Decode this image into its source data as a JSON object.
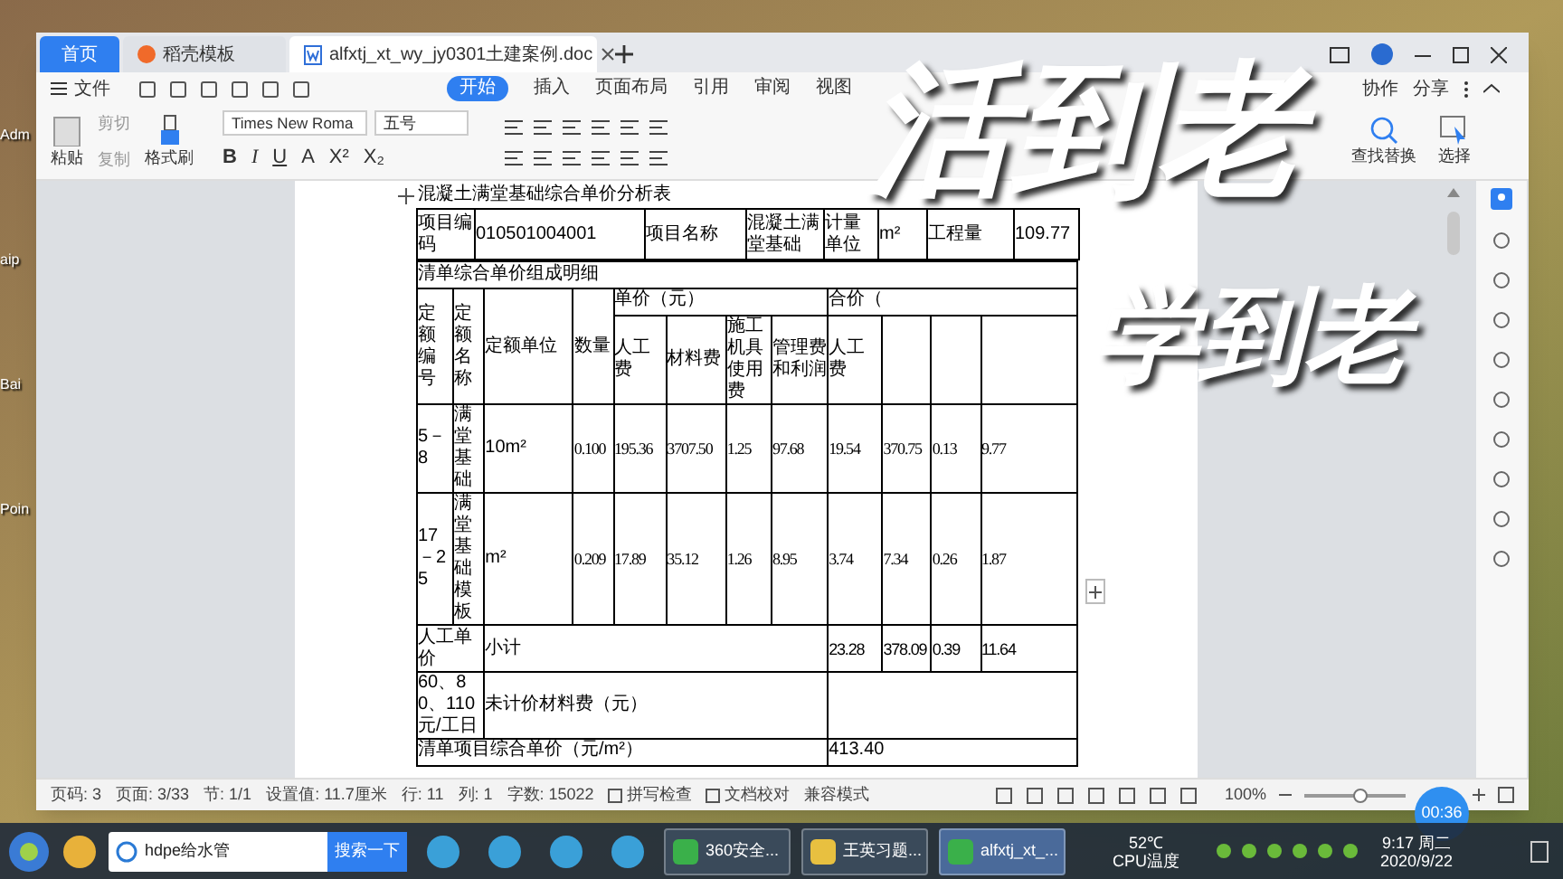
{
  "desktop_icons": [
    "Adm",
    "aip",
    "Bai",
    "Poin"
  ],
  "tabs": [
    {
      "label": "首页",
      "selected": false,
      "kind": "home"
    },
    {
      "label": "稻壳模板",
      "selected": false,
      "kind": "template"
    },
    {
      "label": "alfxtj_xt_wy_jy0301土建案例.doc",
      "selected": true,
      "kind": "doc"
    }
  ],
  "menu": {
    "file": "文件",
    "tabs": [
      {
        "label": "开始",
        "selected": true
      },
      {
        "label": "插入",
        "selected": false
      },
      {
        "label": "页面布局",
        "selected": false
      },
      {
        "label": "引用",
        "selected": false
      },
      {
        "label": "审阅",
        "selected": false
      },
      {
        "label": "视图",
        "selected": false
      }
    ],
    "right": [
      "协作",
      "分享"
    ]
  },
  "ribbon": {
    "clipboard": [
      "粘贴",
      "剪切",
      "复制",
      "格式刷"
    ],
    "font_name": "Times New Roma",
    "font_size": "五号",
    "format_glyphs": [
      "B",
      "I",
      "U",
      "A",
      "X²",
      "X₂"
    ],
    "find": [
      "查找替换",
      "选择"
    ]
  },
  "document": {
    "title": "混凝土满堂基础综合单价分析表",
    "item_row": [
      "项目编码",
      "010501004001",
      "项目名称",
      "混凝土满堂基础",
      "计量单位",
      "m²",
      "工程量",
      "109.77"
    ],
    "section": "清单综合单价组成明细",
    "header_top": [
      "定额编号",
      "定额名称",
      "定额单位",
      "数量",
      "单价（元）",
      "合价（"
    ],
    "header_sub": [
      "人工费",
      "材料费",
      "施工机具使用费",
      "管理费和利润",
      "人工费"
    ],
    "rows": [
      [
        "5－8",
        "满堂基础",
        "10m²",
        "0.100",
        "195.36",
        "3707.50",
        "1.25",
        "97.68",
        "19.54",
        "370.75",
        "0.13",
        "9.77"
      ],
      [
        "17－25",
        "满堂基础模板",
        "m²",
        "0.209",
        "17.89",
        "35.12",
        "1.26",
        "8.95",
        "3.74",
        "7.34",
        "0.26",
        "1.87"
      ]
    ],
    "subtotal": {
      "label": "人工单价",
      "name": "小计",
      "values": [
        "23.28",
        "378.09",
        "0.39",
        "11.64"
      ]
    },
    "unpriced": {
      "label": "60、80、110元/工日",
      "name": "未计价材料费（元）"
    },
    "total": {
      "name": "清单项目综合单价（元/m²）",
      "value": "413.40"
    }
  },
  "status_bar": {
    "items": [
      "页码: 3",
      "页面: 3/33",
      "节: 1/1",
      "设置值: 11.7厘米",
      "行: 11",
      "列: 1",
      "字数: 15022"
    ],
    "checks": [
      "拼写检查",
      "文档校对"
    ],
    "mode": "兼容模式",
    "zoom": "100%",
    "zoom_slider": {
      "level": 0.55
    }
  },
  "timer": "00:36",
  "caption": [
    "活到老",
    "学到老"
  ],
  "taskbar": {
    "search": {
      "value": "hdpe给水管",
      "button": "搜索一下"
    },
    "windows": [
      {
        "label": "360安全...",
        "selected": false
      },
      {
        "label": "王英习题...",
        "selected": false
      },
      {
        "label": "alfxtj_xt_...",
        "selected": true
      }
    ],
    "cpu": {
      "temp": "52℃",
      "label": "CPU温度"
    },
    "time": "9:17 周二",
    "date": "2020/9/22"
  }
}
